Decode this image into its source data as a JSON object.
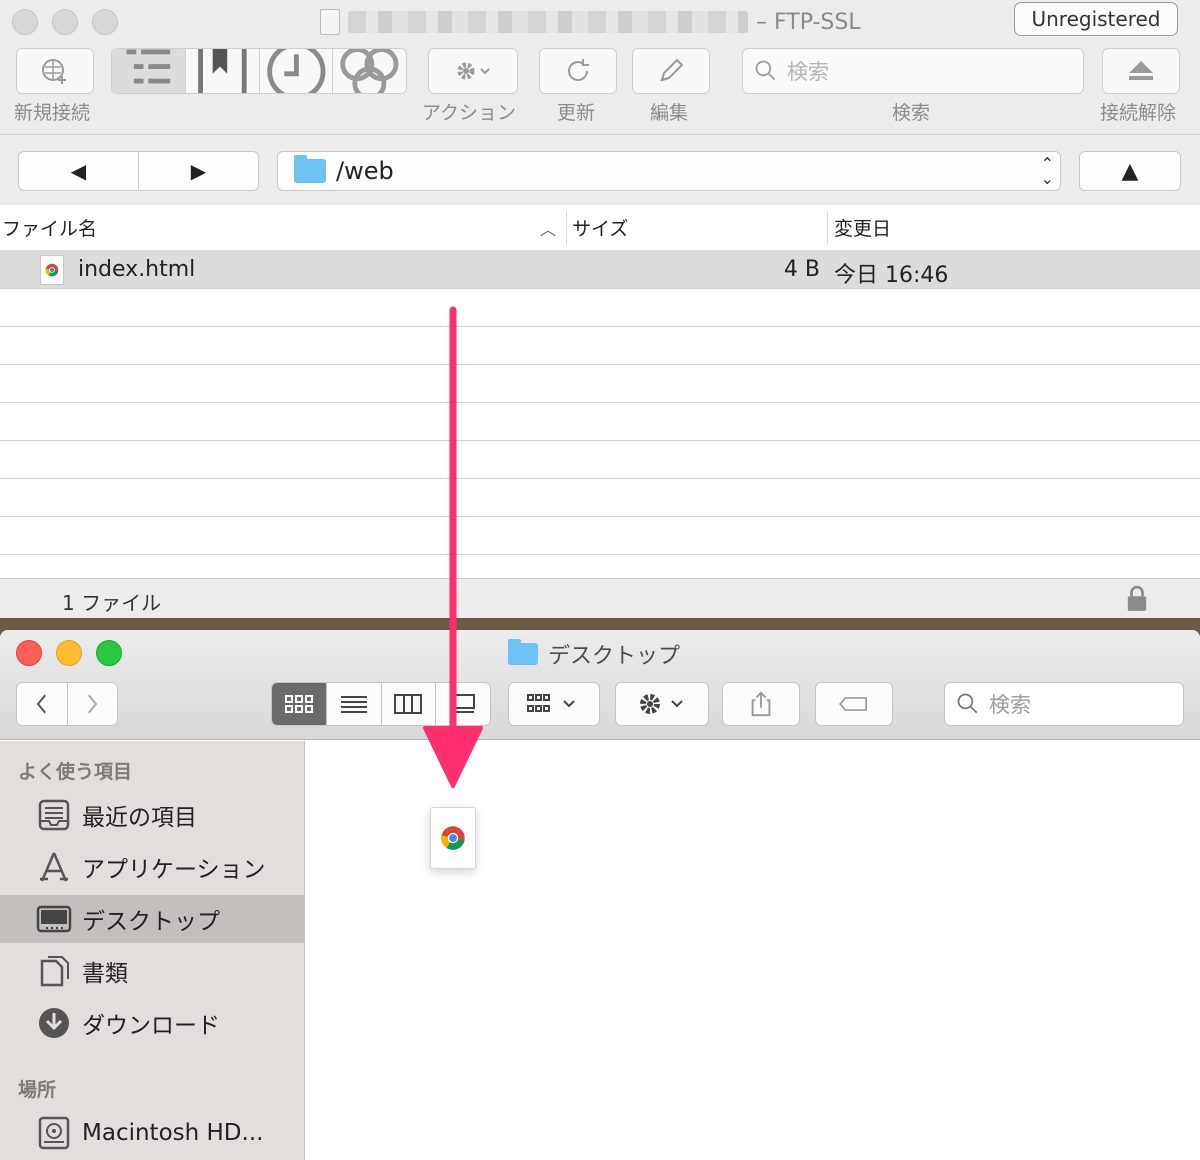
{
  "ftp": {
    "title_suffix": "– FTP-SSL",
    "unregistered_label": "Unregistered",
    "toolbar": {
      "new_connection": "新規接続",
      "action": "アクション",
      "refresh": "更新",
      "edit": "編集",
      "search": "検索",
      "disconnect": "接続解除",
      "search_placeholder": "検索"
    },
    "nav": {
      "back": "◀",
      "forward": "▶",
      "path": "/web",
      "up": "▲"
    },
    "columns": {
      "name": "ファイル名",
      "size": "サイズ",
      "modified": "変更日"
    },
    "files": [
      {
        "name": "index.html",
        "size": "4 B",
        "modified": "今日 16:46"
      }
    ],
    "status": "1 ファイル"
  },
  "finder": {
    "title": "デスクトップ",
    "search_placeholder": "検索",
    "sidebar": {
      "favorites_header": "よく使う項目",
      "items": [
        {
          "label": "最近の項目",
          "icon": "recents-icon"
        },
        {
          "label": "アプリケーション",
          "icon": "applications-icon"
        },
        {
          "label": "デスクトップ",
          "icon": "desktop-icon"
        },
        {
          "label": "書類",
          "icon": "documents-icon"
        },
        {
          "label": "ダウンロード",
          "icon": "downloads-icon"
        }
      ],
      "locations_header": "場所",
      "locations": [
        {
          "label": "Macintosh HD...",
          "icon": "hard-drive-icon"
        }
      ]
    }
  },
  "colors": {
    "arrow": "#fe2f6f",
    "folder": "#6ec2f4",
    "sidebar_bg": "#e3dedb"
  }
}
